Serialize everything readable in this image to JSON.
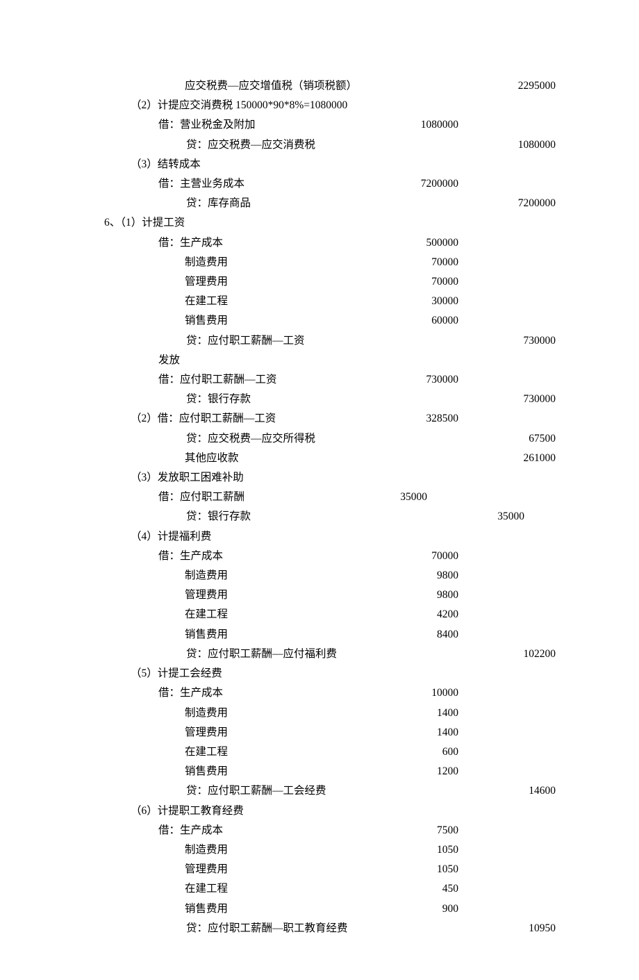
{
  "lines": [
    {
      "cls": "ind4",
      "desc": "应交税费—应交增值税（销项税额）",
      "credit": "2295000"
    },
    {
      "cls": "ind1",
      "desc": "（2）计提应交消费税 150000*90*8%=1080000"
    },
    {
      "cls": "ind2",
      "desc": "借：营业税金及附加",
      "debit": "1080000"
    },
    {
      "cls": "ind3",
      "desc": "贷：应交税费—应交消费税",
      "credit": "1080000"
    },
    {
      "cls": "ind1",
      "desc": "（3）结转成本"
    },
    {
      "cls": "ind2",
      "desc": "借：主营业务成本",
      "debit": "7200000"
    },
    {
      "cls": "ind3",
      "desc": "贷：库存商品",
      "credit": "7200000"
    },
    {
      "cls": "ind0",
      "desc": "6、（1）计提工资"
    },
    {
      "cls": "ind2",
      "desc": "借：生产成本",
      "debit": "500000"
    },
    {
      "cls": "ind4",
      "desc": "制造费用",
      "debit": "70000"
    },
    {
      "cls": "ind4",
      "desc": "管理费用",
      "debit": "70000"
    },
    {
      "cls": "ind4",
      "desc": "在建工程",
      "debit": "30000"
    },
    {
      "cls": "ind4",
      "desc": "销售费用",
      "debit": "60000"
    },
    {
      "cls": "ind3",
      "desc": "贷：应付职工薪酬—工资",
      "credit": "730000"
    },
    {
      "cls": "ind2",
      "desc": "发放"
    },
    {
      "cls": "ind2",
      "desc": "借：应付职工薪酬—工资",
      "debit": "730000"
    },
    {
      "cls": "ind3",
      "desc": "贷：银行存款",
      "credit": "730000"
    },
    {
      "cls": "ind1",
      "desc": "（2）借：应付职工薪酬—工资",
      "debit": "328500"
    },
    {
      "cls": "ind3",
      "desc": "贷：应交税费—应交所得税",
      "credit": "67500"
    },
    {
      "cls": "ind4",
      "desc": "其他应收款",
      "credit": "261000"
    },
    {
      "cls": "ind1",
      "desc": "（3）发放职工困难补助"
    },
    {
      "cls": "ind2 offsetL",
      "desc": "借：应付职工薪酬",
      "debit": "35000"
    },
    {
      "cls": "ind3 offsetC",
      "desc": "贷：银行存款",
      "credit": "35000"
    },
    {
      "cls": "ind1",
      "desc": "（4）计提福利费"
    },
    {
      "cls": "ind2",
      "desc": "借：生产成本",
      "debit": "70000"
    },
    {
      "cls": "ind4",
      "desc": "制造费用",
      "debit": "9800"
    },
    {
      "cls": "ind4",
      "desc": "管理费用",
      "debit": "9800"
    },
    {
      "cls": "ind4",
      "desc": "在建工程",
      "debit": "4200"
    },
    {
      "cls": "ind4",
      "desc": "销售费用",
      "debit": "8400"
    },
    {
      "cls": "ind3",
      "desc": "贷：应付职工薪酬—应付福利费",
      "credit": "102200"
    },
    {
      "cls": "ind1",
      "desc": "（5）计提工会经费"
    },
    {
      "cls": "ind2",
      "desc": "借：生产成本",
      "debit": "10000"
    },
    {
      "cls": "ind4",
      "desc": "制造费用",
      "debit": "1400"
    },
    {
      "cls": "ind4",
      "desc": "管理费用",
      "debit": "1400"
    },
    {
      "cls": "ind4",
      "desc": "在建工程",
      "debit": "600"
    },
    {
      "cls": "ind4",
      "desc": "销售费用",
      "debit": "1200"
    },
    {
      "cls": "ind3",
      "desc": "贷：应付职工薪酬—工会经费",
      "credit": "14600"
    },
    {
      "cls": "ind1",
      "desc": "（6）计提职工教育经费"
    },
    {
      "cls": "ind2",
      "desc": "借：生产成本",
      "debit": "7500"
    },
    {
      "cls": "ind4",
      "desc": "制造费用",
      "debit": "1050"
    },
    {
      "cls": "ind4",
      "desc": "管理费用",
      "debit": "1050"
    },
    {
      "cls": "ind4",
      "desc": "在建工程",
      "debit": "450"
    },
    {
      "cls": "ind4",
      "desc": "销售费用",
      "debit": "900"
    },
    {
      "cls": "ind3",
      "desc": "贷：应付职工薪酬—职工教育经费",
      "credit": "10950"
    }
  ]
}
